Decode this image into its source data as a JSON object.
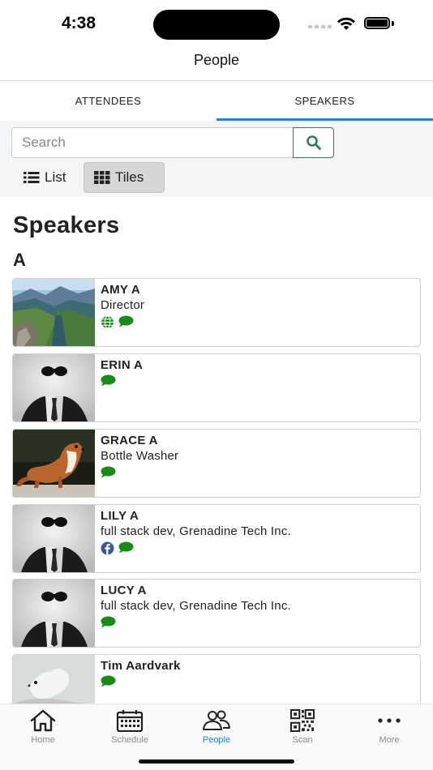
{
  "status_bar": {
    "time": "4:38"
  },
  "nav": {
    "title": "People"
  },
  "tabs": [
    {
      "label": "ATTENDEES",
      "active": false
    },
    {
      "label": "SPEAKERS",
      "active": true
    }
  ],
  "search": {
    "placeholder": "Search",
    "value": ""
  },
  "view_toggle": {
    "list_label": "List",
    "tiles_label": "Tiles",
    "selected": "Tiles"
  },
  "section": {
    "title": "Speakers",
    "letter": "A"
  },
  "speakers": [
    {
      "name": "AMY A",
      "role": "Director",
      "image": "mountain-landscape",
      "icons": [
        "globe-icon",
        "chat-icon"
      ]
    },
    {
      "name": "ERIN A",
      "role": "",
      "image": "invisible-man-sunglasses",
      "icons": [
        "chat-icon"
      ]
    },
    {
      "name": "GRACE A",
      "role": "Bottle Washer",
      "image": "weasel",
      "icons": [
        "chat-icon"
      ]
    },
    {
      "name": "LILY A",
      "role": "full stack dev, Grenadine Tech Inc.",
      "image": "invisible-man-sunglasses",
      "icons": [
        "facebook-icon",
        "chat-icon"
      ]
    },
    {
      "name": "LUCY A",
      "role": "full stack dev, Grenadine Tech Inc.",
      "image": "invisible-man-sunglasses",
      "icons": [
        "chat-icon"
      ]
    },
    {
      "name": "Tim Aardvark",
      "role": "",
      "image": "white-ermine",
      "icons": [
        "chat-icon"
      ]
    }
  ],
  "tabbar": [
    {
      "label": "Home",
      "icon": "home-icon",
      "active": false
    },
    {
      "label": "Schedule",
      "icon": "calendar-icon",
      "active": false
    },
    {
      "label": "People",
      "icon": "people-icon",
      "active": true
    },
    {
      "label": "Scan",
      "icon": "qr-code-icon",
      "active": false
    },
    {
      "label": "More",
      "icon": "more-icon",
      "active": false
    }
  ],
  "colors": {
    "accent": "#2a7fd4",
    "icon_green": "#1a8a1a",
    "search_border": "#2e7d54",
    "facebook_blue": "#3b5998"
  }
}
